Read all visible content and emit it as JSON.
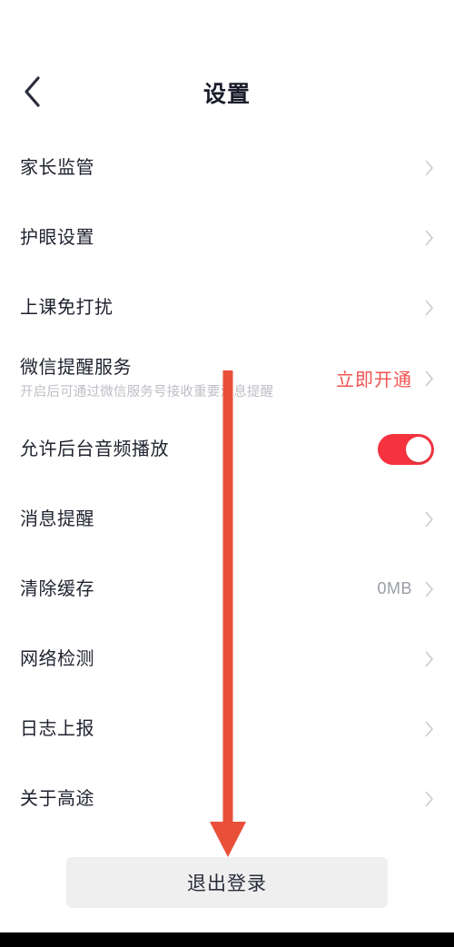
{
  "header": {
    "title": "设置",
    "back_icon": "chevron-left-icon"
  },
  "list": {
    "items": [
      {
        "label": "家长监管",
        "value": "",
        "control": "chevron"
      },
      {
        "label": "护眼设置",
        "value": "",
        "control": "chevron"
      },
      {
        "label": "上课免打扰",
        "value": "",
        "control": "chevron"
      },
      {
        "label": "微信提醒服务",
        "subtitle": "开启后可通过微信服务号接收重要消息提醒",
        "value": "立即开通",
        "control": "chevron",
        "value_style": "accent"
      },
      {
        "label": "允许后台音频播放",
        "value": "",
        "control": "toggle",
        "toggle_on": true
      },
      {
        "label": "消息提醒",
        "value": "",
        "control": "chevron"
      },
      {
        "label": "清除缓存",
        "value": "0MB",
        "control": "chevron"
      },
      {
        "label": "网络检测",
        "value": "",
        "control": "chevron"
      },
      {
        "label": "日志上报",
        "value": "",
        "control": "chevron"
      },
      {
        "label": "关于高途",
        "value": "",
        "control": "chevron"
      }
    ]
  },
  "logout": {
    "label": "退出登录"
  },
  "annotation": {
    "type": "down-arrow",
    "color": "#e8503a",
    "target": "退出登录"
  },
  "colors": {
    "accent_red": "#ef5350",
    "toggle_on": "#f5333f",
    "annotation_red": "#e8503a",
    "title": "#1b1d2b",
    "row_title": "#1f222e",
    "row_subtitle": "#bdbfc6",
    "row_value": "#9a9da6",
    "chevron": "#c9cbd1",
    "logout_bg": "#efefef",
    "background": "#ffffff",
    "home_bar": "#000000"
  }
}
